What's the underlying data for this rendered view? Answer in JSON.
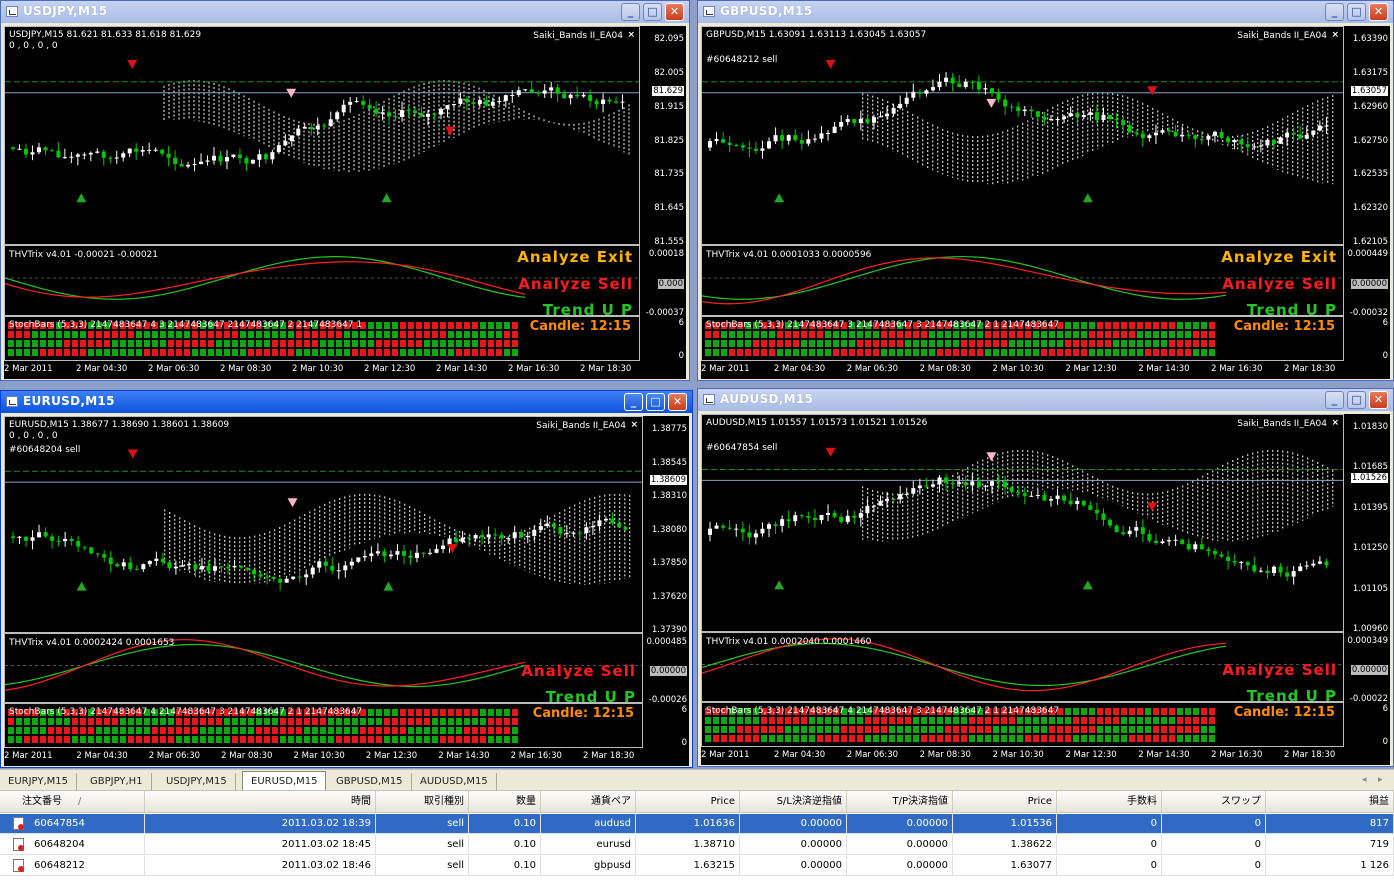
{
  "windows": [
    {
      "id": "usdjpy",
      "title": "USDJPY,M15",
      "info": "USDJPY,M15  81.621 81.633 81.618 81.629",
      "info2": "0 , 0 , 0 , 0",
      "order_label": "",
      "ea_label": "Saiki_Bands II_EA04",
      "price_axis": [
        "82.095",
        "82.005",
        "81.915",
        "81.825",
        "81.735",
        "81.645",
        "81.555"
      ],
      "current_price": "81.629",
      "trix_label": "THVTrix v4.01 -0.00021 -0.00021",
      "trix_axis": [
        "0.00018",
        "0.000",
        "-0.00037"
      ],
      "signals": [
        "Analyze Exit",
        "Analyze Sell",
        "Trend U P"
      ],
      "stoch_label": "StochBars (5,3,3) 2147483647 4 3 2147483647 2147483647 2 2147483647 1",
      "candle_label": "Candle:  12:15",
      "stoch_axis": [
        "6",
        "0"
      ],
      "time_axis": [
        "2 Mar 2011",
        "2 Mar 04:30",
        "2 Mar 06:30",
        "2 Mar 08:30",
        "2 Mar 10:30",
        "2 Mar 12:30",
        "2 Mar 14:30",
        "2 Mar 16:30",
        "2 Mar 18:30"
      ]
    },
    {
      "id": "gbpusd",
      "title": "GBPUSD,M15",
      "info": "GBPUSD,M15  1.63091 1.63113 1.63045 1.63057",
      "info2": "",
      "order_label": "#60648212 sell",
      "ea_label": "Saiki_Bands II_EA04",
      "price_axis": [
        "1.63390",
        "1.63175",
        "1.62960",
        "1.62750",
        "1.62535",
        "1.62320",
        "1.62105"
      ],
      "current_price": "1.63057",
      "trix_label": "THVTrix v4.01 0.0001033 0.0000596",
      "trix_axis": [
        "0.000449",
        "0.00000",
        "-0.00032"
      ],
      "signals": [
        "Analyze Exit",
        "Analyze Sell",
        "Trend U P"
      ],
      "stoch_label": "StochBars (5,3,3) 2147483647 3 2147483647 3 2147483647 2 1 2147483647",
      "candle_label": "Candle:  12:15",
      "stoch_axis": [
        "6",
        "0"
      ],
      "time_axis": [
        "2 Mar 2011",
        "2 Mar 04:30",
        "2 Mar 06:30",
        "2 Mar 08:30",
        "2 Mar 10:30",
        "2 Mar 12:30",
        "2 Mar 14:30",
        "2 Mar 16:30",
        "2 Mar 18:30"
      ]
    },
    {
      "id": "eurusd",
      "title": "EURUSD,M15",
      "info": "EURUSD,M15  1.38677 1.38690 1.38601 1.38609",
      "info2": "0 , 0 , 0 , 0",
      "order_label": "#60648204 sell",
      "ea_label": "Saiki_Bands II_EA04",
      "price_axis": [
        "1.38775",
        "1.38545",
        "1.38310",
        "1.38080",
        "1.37850",
        "1.37620",
        "1.37390"
      ],
      "current_price": "1.38609",
      "trix_label": "THVTrix v4.01 0.0002424 0.0001653",
      "trix_axis": [
        "0.000485",
        "0.00000",
        "-0.00026"
      ],
      "signals": [
        "",
        "Analyze Sell",
        "Trend U P"
      ],
      "stoch_label": "StochBars (5,3,3) 2147483647 4 2147483647 3 2147483647 2 1 2147483647",
      "candle_label": "Candle:  12:15",
      "stoch_axis": [
        "6",
        "0"
      ],
      "time_axis": [
        "2 Mar 2011",
        "2 Mar 04:30",
        "2 Mar 06:30",
        "2 Mar 08:30",
        "2 Mar 10:30",
        "2 Mar 12:30",
        "2 Mar 14:30",
        "2 Mar 16:30",
        "2 Mar 18:30"
      ]
    },
    {
      "id": "audusd",
      "title": "AUDUSD,M15",
      "info": "AUDUSD,M15  1.01557 1.01573 1.01521 1.01526",
      "info2": "",
      "order_label": "#60647854 sell",
      "ea_label": "Saiki_Bands II_EA04",
      "price_axis": [
        "1.01830",
        "1.01685",
        "1.01395",
        "1.01250",
        "1.01105",
        "1.00960"
      ],
      "current_price": "1.01526",
      "trix_label": "THVTrix v4.01 0.0002040 0.0001460",
      "trix_axis": [
        "0.000349",
        "0.00000",
        "-0.00022"
      ],
      "signals": [
        "",
        "Analyze Sell",
        "Trend U P"
      ],
      "stoch_label": "StochBars (5,3,3) 2147483647 4 2147483647 3 2147483647 2 1 2147483647",
      "candle_label": "Candle:  12:15",
      "stoch_axis": [
        "6",
        "0"
      ],
      "time_axis": [
        "2 Mar 2011",
        "2 Mar 04:30",
        "2 Mar 06:30",
        "2 Mar 08:30",
        "2 Mar 10:30",
        "2 Mar 12:30",
        "2 Mar 14:30",
        "2 Mar 16:30",
        "2 Mar 18:30"
      ]
    }
  ],
  "window_buttons": {
    "minimize": "_",
    "maximize": "□",
    "close": "✕",
    "chart_close": "×"
  },
  "tabs": [
    "EURJPY,M15",
    "GBPJPY,H1",
    "USDJPY,M15",
    "EURUSD,M15",
    "GBPUSD,M15",
    "AUDUSD,M15"
  ],
  "active_tab": "EURUSD,M15",
  "tab_nav": {
    "left": "◂",
    "right": "▸"
  },
  "table": {
    "columns": [
      "注文番号",
      "時間",
      "取引種別",
      "数量",
      "通貨ペア",
      "Price",
      "S/L決済逆指値",
      "T/P決済指値",
      "Price",
      "手数料",
      "スワップ",
      "損益"
    ],
    "sort_marker": "/",
    "rows": [
      [
        "60647854",
        "2011.03.02 18:39",
        "sell",
        "0.10",
        "audusd",
        "1.01636",
        "0.00000",
        "0.00000",
        "1.01536",
        "0",
        "0",
        "817"
      ],
      [
        "60648204",
        "2011.03.02 18:45",
        "sell",
        "0.10",
        "eurusd",
        "1.38710",
        "0.00000",
        "0.00000",
        "1.38622",
        "0",
        "0",
        "719"
      ],
      [
        "60648212",
        "2011.03.02 18:46",
        "sell",
        "0.10",
        "gbpusd",
        "1.63215",
        "0.00000",
        "0.00000",
        "1.63077",
        "0",
        "0",
        "1 126"
      ]
    ]
  },
  "colors": {
    "bull": "#ffffff",
    "bear": "#00c800",
    "signal_sell": "#ff1a1a",
    "signal_exit": "#ffb200",
    "trend_up": "#22c822",
    "candle": "#ff8c00",
    "active_title": "#0a52dc"
  }
}
